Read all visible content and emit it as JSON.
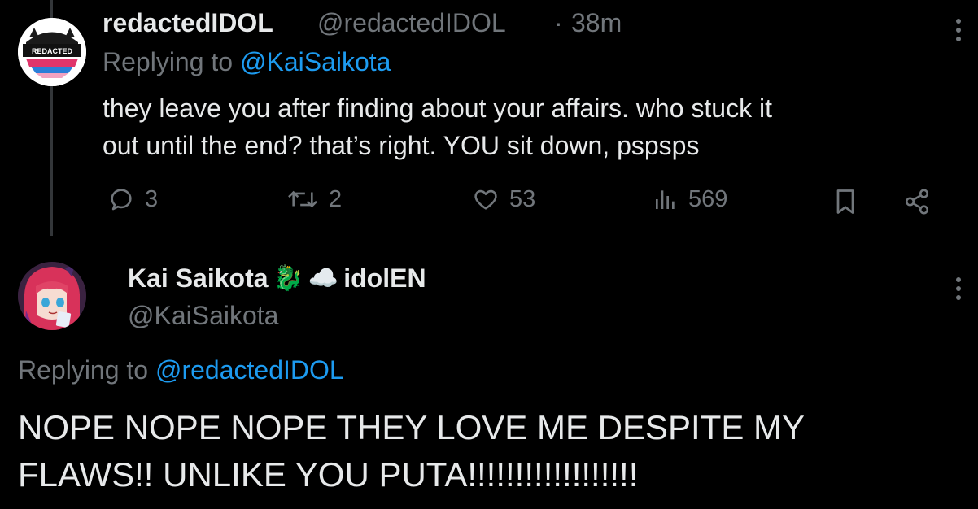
{
  "tweet1": {
    "display_name": "redactedIDOL",
    "handle": "@redactedIDOL",
    "separator": "·",
    "time": "38m",
    "replying_prefix": "Replying to",
    "replying_to": "@KaiSaikota",
    "text_line1": "they leave you after finding about your affairs. who stuck it",
    "text_line2": "out until the end? that’s right. YOU sit down, pspsps",
    "avatar_text": "REDACTED",
    "reply_count": "3",
    "retweet_count": "2",
    "like_count": "53",
    "view_count": "569"
  },
  "tweet2": {
    "display_name": "Kai Saikota",
    "emoji_dragon": "🐉",
    "emoji_cloud": "☁️",
    "name_suffix": "idolEN",
    "handle": "@KaiSaikota",
    "replying_prefix": "Replying to",
    "replying_to": "@redactedIDOL",
    "text_line1": "NOPE NOPE NOPE THEY LOVE ME DESPITE MY",
    "text_line2": "FLAWS!! UNLIKE YOU PUTA!!!!!!!!!!!!!!!!!!"
  },
  "colors": {
    "background": "#000000",
    "text": "#e7e9ea",
    "secondary": "#71767b",
    "link": "#1d9bf0"
  },
  "icons": [
    "reply-icon",
    "retweet-icon",
    "like-icon",
    "views-icon",
    "bookmark-icon",
    "share-icon",
    "more-icon"
  ]
}
